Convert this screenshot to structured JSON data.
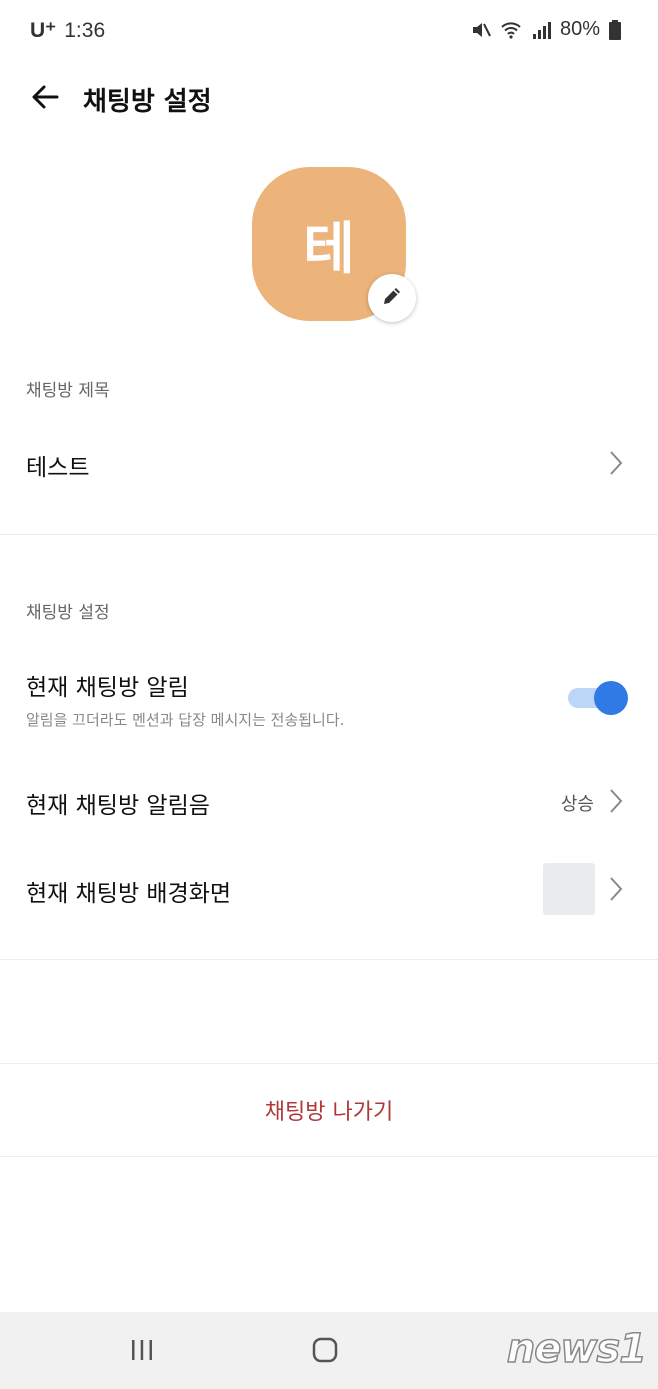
{
  "status_bar": {
    "carrier": "U⁺",
    "time": "1:36",
    "battery": "80%",
    "icons": [
      "mute-icon",
      "wifi-icon",
      "signal-icon",
      "battery-icon"
    ]
  },
  "app_bar": {
    "title": "채팅방 설정",
    "back_icon": "arrow-left-icon"
  },
  "profile": {
    "avatar_letter": "테",
    "avatar_color": "#ecb37a",
    "edit_icon": "pencil-icon"
  },
  "title_section": {
    "label": "채팅방 제목",
    "value": "테스트"
  },
  "settings_section": {
    "label": "채팅방 설정",
    "notification": {
      "title": "현재 채팅방 알림",
      "subtitle": "알림을 끄더라도 멘션과 답장 메시지는 전송됩니다.",
      "enabled": true,
      "accent": "#2f7ae5"
    },
    "sound": {
      "title": "현재 채팅방 알림음",
      "value": "상승"
    },
    "background": {
      "title": "현재 채팅방 배경화면",
      "swatch_color": "#e9ebed"
    }
  },
  "leave": {
    "label": "채팅방 나가기",
    "color": "#b0383a"
  },
  "nav_bar": {
    "icons": [
      "recent-apps-icon",
      "home-icon"
    ]
  },
  "watermark": "news1"
}
